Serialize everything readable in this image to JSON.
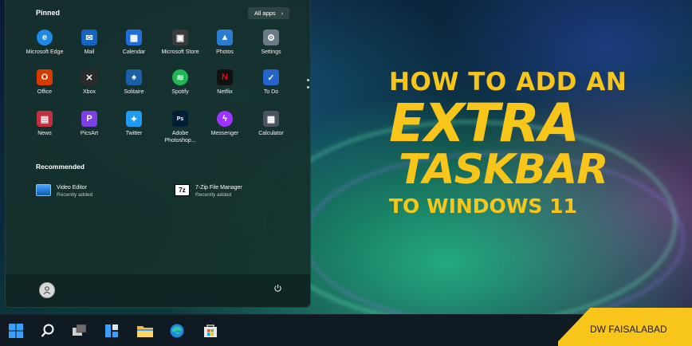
{
  "start_menu": {
    "pinned_title": "Pinned",
    "all_apps_label": "All apps",
    "all_apps_chevron": "›",
    "apps": [
      {
        "label": "Microsoft Edge",
        "icon": "edge-icon",
        "color": "#1e88e5"
      },
      {
        "label": "Mail",
        "icon": "mail-icon",
        "color": "#1565c0"
      },
      {
        "label": "Calendar",
        "icon": "calendar-icon",
        "color": "#1e6fd9"
      },
      {
        "label": "Microsoft Store",
        "icon": "store-icon",
        "color": "#3a3a3a"
      },
      {
        "label": "Photos",
        "icon": "photos-icon",
        "color": "#2b7bd1"
      },
      {
        "label": "Settings",
        "icon": "settings-icon",
        "color": "#6b7a86"
      },
      {
        "label": "Office",
        "icon": "office-icon",
        "color": "#d83b01"
      },
      {
        "label": "Xbox",
        "icon": "xbox-icon",
        "color": "#2b2b2b"
      },
      {
        "label": "Solitaire",
        "icon": "solitaire-icon",
        "color": "#1b5fa8"
      },
      {
        "label": "Spotify",
        "icon": "spotify-icon",
        "color": "#1db954"
      },
      {
        "label": "Netflix",
        "icon": "netflix-icon",
        "color": "#111111"
      },
      {
        "label": "To Do",
        "icon": "todo-icon",
        "color": "#2564cf"
      },
      {
        "label": "News",
        "icon": "news-icon",
        "color": "#c6303e"
      },
      {
        "label": "PicsArt",
        "icon": "picsart-icon",
        "color": "#7b3fe4"
      },
      {
        "label": "Twitter",
        "icon": "twitter-icon",
        "color": "#1d9bf0"
      },
      {
        "label": "Adobe Photoshop...",
        "icon": "photoshop-icon",
        "color": "#001e36"
      },
      {
        "label": "Messenger",
        "icon": "messenger-icon",
        "color": "#a033ff"
      },
      {
        "label": "Calculator",
        "icon": "calculator-icon",
        "color": "#4a5560"
      }
    ],
    "recommended_title": "Recommended",
    "recommended": [
      {
        "name": "Video Editor",
        "sub": "Recently added",
        "icon": "video-editor-icon"
      },
      {
        "name": "7-Zip File Manager",
        "sub": "Recently added",
        "icon": "7zip-icon",
        "glyph": "7z"
      }
    ]
  },
  "headline": {
    "line1": "HOW TO ADD AN",
    "line2": "EXTRA",
    "line3": "TASKBAR",
    "line4": "TO WINDOWS 11"
  },
  "taskbar": {
    "items": [
      "windows-start-icon",
      "search-icon",
      "task-view-icon",
      "widgets-icon",
      "file-explorer-icon",
      "edge-icon",
      "store-icon"
    ]
  },
  "badge": {
    "text": "DW FAISALABAD"
  },
  "colors": {
    "accent_yellow": "#f8c61a",
    "menu_bg": "#16302c",
    "taskbar_bg": "#0f1a22"
  }
}
